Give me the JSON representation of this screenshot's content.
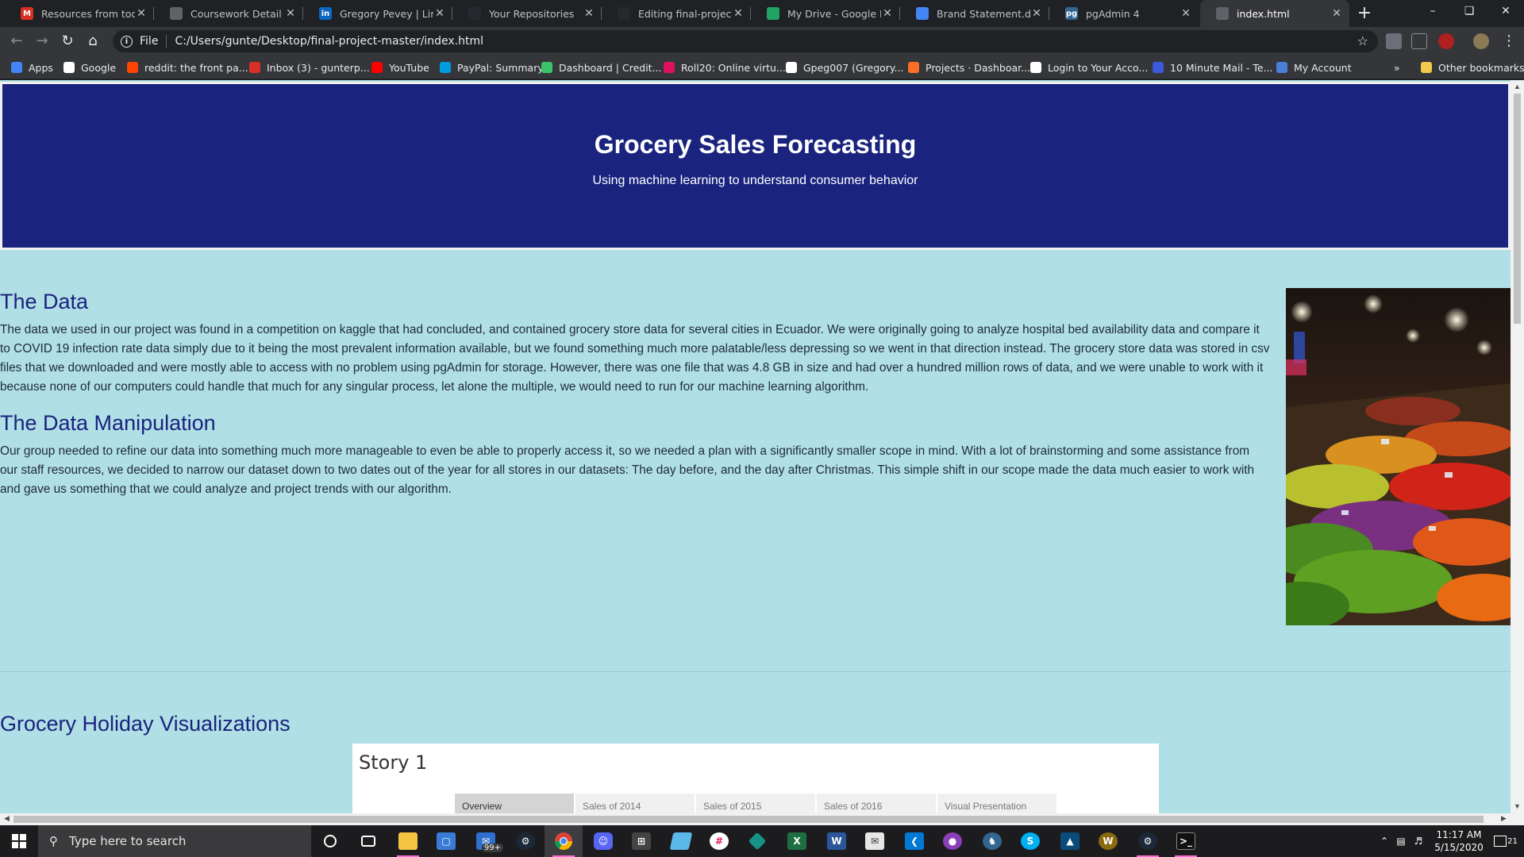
{
  "browser": {
    "tabs": [
      {
        "title": "Resources from today's",
        "icon": "gmail-icon",
        "color": "#d93025",
        "glyph": "M"
      },
      {
        "title": "Coursework Detail | Bo",
        "icon": "globe-icon",
        "color": "#5f6368",
        "glyph": ""
      },
      {
        "title": "Gregory Pevey | Linked",
        "icon": "linkedin-icon",
        "color": "#0a66c2",
        "glyph": "in"
      },
      {
        "title": "Your Repositories",
        "icon": "github-icon",
        "color": "#24292e",
        "glyph": ""
      },
      {
        "title": "Editing final-project/RE",
        "icon": "github-icon",
        "color": "#24292e",
        "glyph": ""
      },
      {
        "title": "My Drive - Google Driv",
        "icon": "google-drive-icon",
        "color": "#1fa463",
        "glyph": ""
      },
      {
        "title": "Brand Statement.docx",
        "icon": "google-docs-icon",
        "color": "#4285f4",
        "glyph": ""
      },
      {
        "title": "pgAdmin 4",
        "icon": "pgadmin-icon",
        "color": "#326690",
        "glyph": "pg"
      },
      {
        "title": "index.html",
        "icon": "globe-icon",
        "color": "#5f6368",
        "glyph": "",
        "active": true
      }
    ],
    "address": {
      "scheme": "File",
      "url": "C:/Users/gunte/Desktop/final-project-master/index.html"
    },
    "bookmarks": [
      {
        "label": "Apps",
        "icon": "apps-grid-icon",
        "color": "#4285f4"
      },
      {
        "label": "Google",
        "icon": "google-icon",
        "color": "#ffffff"
      },
      {
        "label": "reddit: the front pa...",
        "icon": "reddit-icon",
        "color": "#ff4500"
      },
      {
        "label": "Inbox (3) - gunterp...",
        "icon": "gmail-icon",
        "color": "#d93025"
      },
      {
        "label": "YouTube",
        "icon": "youtube-icon",
        "color": "#ff0000"
      },
      {
        "label": "PayPal: Summary",
        "icon": "paypal-icon",
        "color": "#009cde"
      },
      {
        "label": "Dashboard | Credit...",
        "icon": "creditkarma-icon",
        "color": "#3cc46c"
      },
      {
        "label": "Roll20: Online virtu...",
        "icon": "roll20-icon",
        "color": "#e0115f"
      },
      {
        "label": "Gpeg007 (Gregory...",
        "icon": "github-icon",
        "color": "#ffffff"
      },
      {
        "label": "Projects · Dashboar...",
        "icon": "gitlab-icon",
        "color": "#fc6d26"
      },
      {
        "label": "Login to Your Acco...",
        "icon": "globe-icon",
        "color": "#ffffff"
      },
      {
        "label": "10 Minute Mail - Te...",
        "icon": "tenminutemail-icon",
        "color": "#3b5bdb"
      },
      {
        "label": "My Account",
        "icon": "account-icon",
        "color": "#4a7fd8"
      }
    ],
    "other_bookmarks": "Other bookmarks",
    "overflow": "»"
  },
  "page": {
    "hero_title": "Grocery Sales Forecasting",
    "hero_subtitle": "Using machine learning to understand consumer behavior",
    "sections": [
      {
        "heading": "The Data",
        "body": "The data we used in our project was found in a competition on kaggle that had concluded, and contained grocery store data for several cities in Ecuador. We were originally going to analyze hospital bed availability data and compare it to COVID 19 infection rate data simply due to it being the most prevalent information available, but we found something much more palatable/less depressing so we went in that direction instead. The grocery store data was stored in csv files that we downloaded and were mostly able to access with no problem using pgAdmin for storage. However, there was one file that was 4.8 GB in size and had over a hundred million rows of data, and we were unable to work with it because none of our computers could handle that much for any singular process, let alone the multiple, we would need to run for our machine learning algorithm."
      },
      {
        "heading": "The Data Manipulation",
        "body": "Our group needed to refine our data into something much more manageable to even be able to properly access it, so we needed a plan with a significantly smaller scope in mind. With a lot of brainstorming and some assistance from our staff resources, we decided to narrow our dataset down to two dates out of the year for all stores in our datasets: The day before, and the day after Christmas. This simple shift in our scope made the data much easier to work with and gave us something that we could analyze and project trends with our algorithm."
      }
    ],
    "viz_heading": "Grocery Holiday Visualizations",
    "story_title": "Story 1",
    "story_tabs": [
      "Overview",
      "Sales of 2014",
      "Sales of 2015",
      "Sales of 2016",
      "Visual Presentation"
    ],
    "colors": {
      "hero_bg": "#1a237e",
      "page_bg": "#b0dfe5",
      "heading": "#1a237e"
    }
  },
  "taskbar": {
    "search_placeholder": "Type here to search",
    "mail_badge": "99+",
    "time": "11:17 AM",
    "date": "5/15/2020",
    "notifications": "21"
  }
}
